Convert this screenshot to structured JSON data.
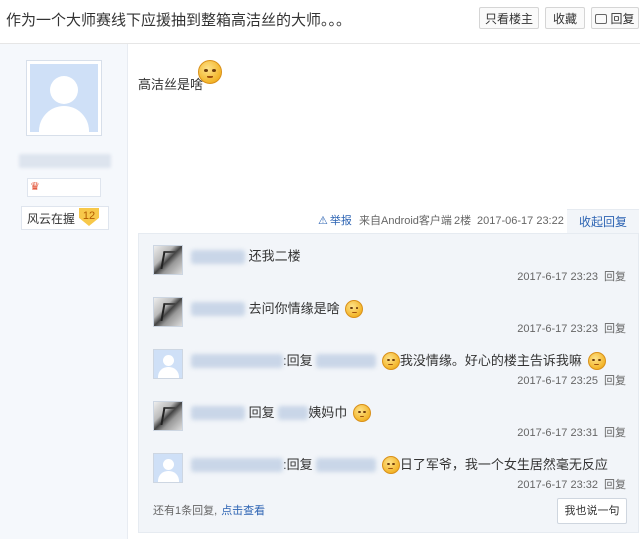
{
  "header": {
    "title": "作为一个大师赛线下应援抽到整箱高洁丝的大师。。。",
    "only_author_label": "只看楼主",
    "favorite_label": "收藏",
    "reply_label": "回复"
  },
  "author": {
    "name": "",
    "level_name": "风云在握",
    "level_number": "12"
  },
  "post": {
    "text": "高洁丝是啥",
    "report_label": "举报",
    "client_label": "来自Android客户端",
    "floor_label": "2楼",
    "time": "2017-06-17 23:22",
    "toggle_label": "收起回复"
  },
  "replies": [
    {
      "avatar": "ink",
      "prefix": "",
      "reply_to": false,
      "text": "还我二楼",
      "time": "2017-6-17 23:23",
      "reply_button": "回复"
    },
    {
      "avatar": "ink",
      "prefix": "",
      "reply_to": false,
      "text": "去问你情缘是啥",
      "time": "2017-6-17 23:23",
      "reply_button": "回复"
    },
    {
      "avatar": "default",
      "prefix": ":回复",
      "reply_to": true,
      "text": "我没情缘。好心的楼主告诉我嘛",
      "time": "2017-6-17 23:25",
      "reply_button": "回复"
    },
    {
      "avatar": "ink",
      "prefix": "回复",
      "reply_to": true,
      "text": "姨妈巾",
      "time": "2017-6-17 23:31",
      "reply_button": "回复"
    },
    {
      "avatar": "default",
      "prefix": ":回复",
      "reply_to": true,
      "text": "日了军爷，我一个女生居然毫无反应",
      "time": "2017-6-17 23:32",
      "reply_button": "回复"
    }
  ],
  "footer": {
    "more_text": "还有1条回复,",
    "more_link": "点击查看",
    "say_button": "我也说一句"
  },
  "colors": {
    "link": "#2d64b3",
    "panel_bg": "#f2f5f9",
    "author_bg": "#f5f8fc"
  }
}
